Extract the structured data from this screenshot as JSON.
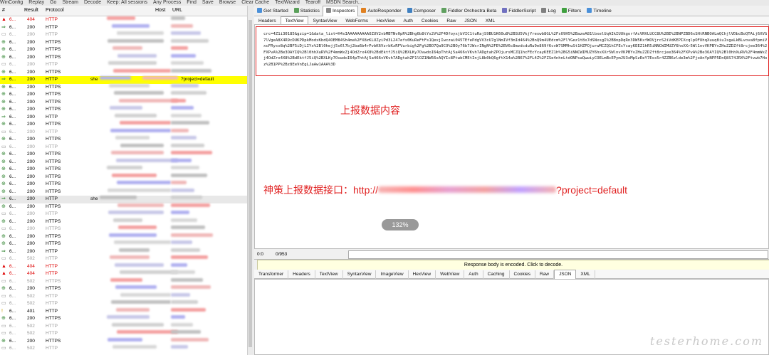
{
  "toolbar": [
    "WinConfig",
    "Replay",
    "Go",
    "Stream",
    "Decode",
    "Keep: All sessions",
    "Any Process",
    "Find",
    "Save",
    "Browse",
    "Clear Cache",
    "TextWizard",
    "Tearoff",
    "MSDN Search..."
  ],
  "list_headers": {
    "num": "#",
    "result": "Result",
    "protocol": "Protocol",
    "host": "Host",
    "url": "URL"
  },
  "rows": [
    {
      "icon": "▲",
      "num": "6...",
      "result": "404",
      "protocol": "HTTP",
      "kind": "err"
    },
    {
      "icon": "⇒",
      "num": "6...",
      "result": "200",
      "protocol": "HTTP",
      "kind": "ok"
    },
    {
      "icon": "▭",
      "num": "6...",
      "result": "200",
      "protocol": "HTTP",
      "kind": "dim"
    },
    {
      "icon": "⊕",
      "num": "6...",
      "result": "200",
      "protocol": "HTTPS",
      "kind": "ok"
    },
    {
      "icon": "⊕",
      "num": "6...",
      "result": "200",
      "protocol": "HTTPS",
      "kind": "ok"
    },
    {
      "icon": "⊕",
      "num": "6...",
      "result": "200",
      "protocol": "HTTPS",
      "kind": "ok"
    },
    {
      "icon": "▭",
      "num": "6...",
      "result": "200",
      "protocol": "HTTP",
      "kind": "dim"
    },
    {
      "icon": "⊕",
      "num": "6...",
      "result": "200",
      "protocol": "HTTPS",
      "kind": "ok"
    },
    {
      "icon": "⇒",
      "num": "6...",
      "result": "200",
      "protocol": "HTTP",
      "kind": "highlight",
      "host": "she",
      "url": "?project=default"
    },
    {
      "icon": "⊕",
      "num": "6...",
      "result": "200",
      "protocol": "HTTPS",
      "kind": "ok"
    },
    {
      "icon": "⊕",
      "num": "6...",
      "result": "200",
      "protocol": "HTTPS",
      "kind": "ok"
    },
    {
      "icon": "⊕",
      "num": "6...",
      "result": "200",
      "protocol": "HTTPS",
      "kind": "ok"
    },
    {
      "icon": "⊕",
      "num": "6...",
      "result": "200",
      "protocol": "HTTPS",
      "kind": "ok"
    },
    {
      "icon": "⇒",
      "num": "6...",
      "result": "200",
      "protocol": "HTTP",
      "kind": "ok"
    },
    {
      "icon": "⊕",
      "num": "6...",
      "result": "200",
      "protocol": "HTTPS",
      "kind": "ok"
    },
    {
      "icon": "▭",
      "num": "6...",
      "result": "200",
      "protocol": "HTTP",
      "kind": "dim"
    },
    {
      "icon": "⊕",
      "num": "6...",
      "result": "200",
      "protocol": "HTTPS",
      "kind": "ok"
    },
    {
      "icon": "▭",
      "num": "6...",
      "result": "200",
      "protocol": "HTTP",
      "kind": "dim"
    },
    {
      "icon": "⊕",
      "num": "6...",
      "result": "200",
      "protocol": "HTTPS",
      "kind": "ok"
    },
    {
      "icon": "⊕",
      "num": "6...",
      "result": "200",
      "protocol": "HTTPS",
      "kind": "ok"
    },
    {
      "icon": "⊕",
      "num": "6...",
      "result": "200",
      "protocol": "HTTPS",
      "kind": "ok"
    },
    {
      "icon": "⊕",
      "num": "6...",
      "result": "200",
      "protocol": "HTTPS",
      "kind": "ok"
    },
    {
      "icon": "⊕",
      "num": "6...",
      "result": "200",
      "protocol": "HTTPS",
      "kind": "ok"
    },
    {
      "icon": "⊕",
      "num": "6...",
      "result": "200",
      "protocol": "HTTPS",
      "kind": "ok"
    },
    {
      "icon": "⇒",
      "num": "6...",
      "result": "200",
      "protocol": "HTTP",
      "kind": "gray",
      "host": "she"
    },
    {
      "icon": "⊕",
      "num": "6...",
      "result": "200",
      "protocol": "HTTPS",
      "kind": "ok"
    },
    {
      "icon": "▭",
      "num": "6...",
      "result": "200",
      "protocol": "HTTP",
      "kind": "dim"
    },
    {
      "icon": "⊕",
      "num": "6...",
      "result": "200",
      "protocol": "HTTPS",
      "kind": "ok"
    },
    {
      "icon": "▭",
      "num": "6...",
      "result": "200",
      "protocol": "HTTPS",
      "kind": "dim"
    },
    {
      "icon": "⊕",
      "num": "6...",
      "result": "200",
      "protocol": "HTTPS",
      "kind": "ok"
    },
    {
      "icon": "⊕",
      "num": "6...",
      "result": "200",
      "protocol": "HTTPS",
      "kind": "ok"
    },
    {
      "icon": "⇒",
      "num": "6...",
      "result": "200",
      "protocol": "HTTP",
      "kind": "ok"
    },
    {
      "icon": "▭",
      "num": "6...",
      "result": "502",
      "protocol": "HTTP",
      "kind": "dim"
    },
    {
      "icon": "▲",
      "num": "6...",
      "result": "404",
      "protocol": "HTTP",
      "kind": "err"
    },
    {
      "icon": "▲",
      "num": "6...",
      "result": "404",
      "protocol": "HTTP",
      "kind": "err"
    },
    {
      "icon": "▭",
      "num": "6...",
      "result": "502",
      "protocol": "HTTPS",
      "kind": "dim"
    },
    {
      "icon": "⊕",
      "num": "6...",
      "result": "200",
      "protocol": "HTTPS",
      "kind": "ok"
    },
    {
      "icon": "▭",
      "num": "6...",
      "result": "502",
      "protocol": "HTTP",
      "kind": "dim"
    },
    {
      "icon": "▭",
      "num": "6...",
      "result": "502",
      "protocol": "HTTP",
      "kind": "dim"
    },
    {
      "icon": "!",
      "num": "6...",
      "result": "401",
      "protocol": "HTTP",
      "kind": "warn"
    },
    {
      "icon": "⊕",
      "num": "6...",
      "result": "200",
      "protocol": "HTTPS",
      "kind": "ok"
    },
    {
      "icon": "▭",
      "num": "6...",
      "result": "502",
      "protocol": "HTTP",
      "kind": "dim"
    },
    {
      "icon": "▭",
      "num": "6...",
      "result": "502",
      "protocol": "HTTP",
      "kind": "dim"
    },
    {
      "icon": "⊕",
      "num": "6...",
      "result": "200",
      "protocol": "HTTPS",
      "kind": "ok"
    },
    {
      "icon": "▭",
      "num": "6...",
      "result": "502",
      "protocol": "HTTP",
      "kind": "dim"
    }
  ],
  "inspector_tabs": [
    "Get Started",
    "Statistics",
    "Inspectors",
    "AutoResponder",
    "Composer",
    "Fiddler Orchestra Beta",
    "FiddlerScript",
    "Log",
    "Filters",
    "Timeline"
  ],
  "inspector_active": "Inspectors",
  "request_tabs": [
    "Headers",
    "TextView",
    "SyntaxView",
    "WebForms",
    "HexView",
    "Auth",
    "Cookies",
    "Raw",
    "JSON",
    "XML"
  ],
  "request_active": "TextView",
  "request_body": "crc=4Z1i30185&gzip=1&data_list=H4sIAAAAAAAAAOZUV2vbMBTNv0pR%2Bhg6b8tYs2V%2F4DfoyxjbVIC1tuRajS9BU1K60u8%2BSU5VkjYrexwb8GL%2FsO9H5%2BazeA81lbxelUqAIkIUUkgorfAcVNVLUCC8U%2BE%2BNPZBD6xSHtRNBOALmQChjlVDbcBoQTAij6XVG7lVgeA8X4R9cDUKPDpkModxKbdQ4OEM84Sh4ma%2FX8zKLUZyiPd3L247efs0KuReFtFs1QexjIwczai045TEfePdgVV3cU7glNmIVf3mId464%2BnQ9m4UEdcm%2FlYGez1t8x7dSNxsgI%2B8npDqRn3DW5KxfWOVjrcS2iVdKEPIXcqlpOFUhqXuuq8iuIsgaLkBLvova8fpmiVxcFRysv8q%2BF5iDjLIYx%2Bl0hejj5s6l7bj2ba6b4rPvbK6VzrbKzRFVurbig%2Fg%2BO7Qa9CO%2BOy76b7JWsrINgN%2FE%2BV6c8mzdcduRu9e869f6cvW7SMMhuSt1HZPOjurwMCZQ1hCFEcYcayKEEZ1hR5iNNCWIMUZY6hxXXr5Wl1nvVKPBYvZHuZZDZft8rcjee364%2FXPvA%2Be3OAYIQ%2Bl0hhXuRV%2F4mmWxZj4OdZrx4X8%2BdEktfJ5iQ%2BXLKy7OvwdoI64pThtAj5a466vVKvh7ADgtahZPOjursMCZQ1hcFEcYcayKEEZ1h%2BG5iNNCWIMUZY6hxXXr5WlnvVKPBYvZHuZZDZft8rcjee364%2FXPvA%2Be3OAYIQ%2Bl0hhXuRV%2F4mmWxZj4OdZrx4X8%2BdEktfJ5iQ%2BXLKy7OvwdoI64pThtAj5a466vVKvh7ADgtahZF1lOZ1NW56sAQYIc8PtwbCMEtInjL8b0kQ6gftX14a%2B67%2FL4Z%2FZSe4nhnLtdONPsaQwwiyCOELmBcEPymJU3xMpSzEeY7Ess5r4ZZB6zlde3m%2FjoAnYpNPP5DnQ8S74JRX%2Ftvwb7Hoz%2B1PP%2Bz8EeVnEgLJaAw1AAA%3D",
  "annotation_body": "上报数据内容",
  "annotation_url_prefix": "神策上报数据接口：http://",
  "annotation_url_suffix": "?project=default",
  "zoom": "132%",
  "status_left": "0:0",
  "status_right": "0/953",
  "encoded_notice": "Response body is encoded. Click to decode.",
  "response_tabs": [
    "Transformer",
    "Headers",
    "TextView",
    "SyntaxView",
    "ImageView",
    "HexView",
    "WebView",
    "Auth",
    "Caching",
    "Cookies",
    "Raw",
    "JSON",
    "XML"
  ],
  "response_active": "JSON",
  "watermark": "testerhome.com",
  "colors": {
    "accent_red": "#e02020",
    "highlight": "#ffff00",
    "error": "#dd0000"
  }
}
